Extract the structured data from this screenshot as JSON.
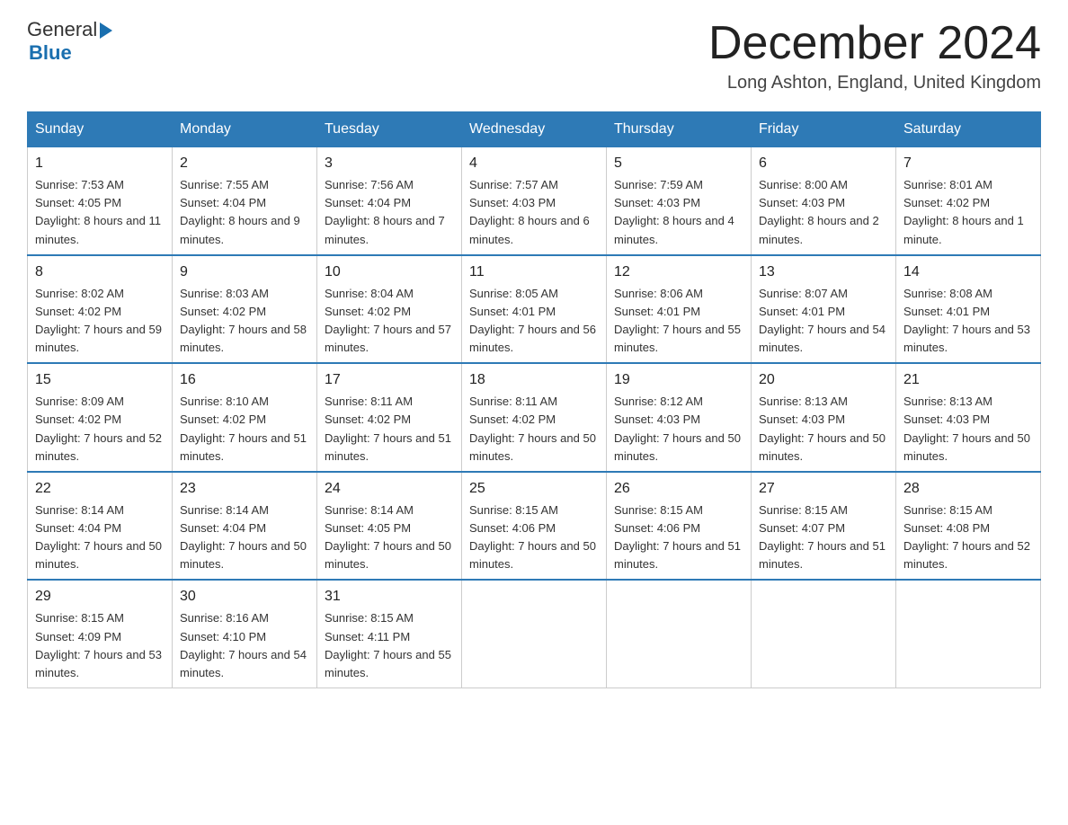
{
  "header": {
    "logo": {
      "general": "General",
      "arrow": "▶",
      "blue": "Blue"
    },
    "title": "December 2024",
    "location": "Long Ashton, England, United Kingdom"
  },
  "weekdays": [
    "Sunday",
    "Monday",
    "Tuesday",
    "Wednesday",
    "Thursday",
    "Friday",
    "Saturday"
  ],
  "weeks": [
    [
      {
        "day": "1",
        "sunrise": "7:53 AM",
        "sunset": "4:05 PM",
        "daylight": "8 hours and 11 minutes."
      },
      {
        "day": "2",
        "sunrise": "7:55 AM",
        "sunset": "4:04 PM",
        "daylight": "8 hours and 9 minutes."
      },
      {
        "day": "3",
        "sunrise": "7:56 AM",
        "sunset": "4:04 PM",
        "daylight": "8 hours and 7 minutes."
      },
      {
        "day": "4",
        "sunrise": "7:57 AM",
        "sunset": "4:03 PM",
        "daylight": "8 hours and 6 minutes."
      },
      {
        "day": "5",
        "sunrise": "7:59 AM",
        "sunset": "4:03 PM",
        "daylight": "8 hours and 4 minutes."
      },
      {
        "day": "6",
        "sunrise": "8:00 AM",
        "sunset": "4:03 PM",
        "daylight": "8 hours and 2 minutes."
      },
      {
        "day": "7",
        "sunrise": "8:01 AM",
        "sunset": "4:02 PM",
        "daylight": "8 hours and 1 minute."
      }
    ],
    [
      {
        "day": "8",
        "sunrise": "8:02 AM",
        "sunset": "4:02 PM",
        "daylight": "7 hours and 59 minutes."
      },
      {
        "day": "9",
        "sunrise": "8:03 AM",
        "sunset": "4:02 PM",
        "daylight": "7 hours and 58 minutes."
      },
      {
        "day": "10",
        "sunrise": "8:04 AM",
        "sunset": "4:02 PM",
        "daylight": "7 hours and 57 minutes."
      },
      {
        "day": "11",
        "sunrise": "8:05 AM",
        "sunset": "4:01 PM",
        "daylight": "7 hours and 56 minutes."
      },
      {
        "day": "12",
        "sunrise": "8:06 AM",
        "sunset": "4:01 PM",
        "daylight": "7 hours and 55 minutes."
      },
      {
        "day": "13",
        "sunrise": "8:07 AM",
        "sunset": "4:01 PM",
        "daylight": "7 hours and 54 minutes."
      },
      {
        "day": "14",
        "sunrise": "8:08 AM",
        "sunset": "4:01 PM",
        "daylight": "7 hours and 53 minutes."
      }
    ],
    [
      {
        "day": "15",
        "sunrise": "8:09 AM",
        "sunset": "4:02 PM",
        "daylight": "7 hours and 52 minutes."
      },
      {
        "day": "16",
        "sunrise": "8:10 AM",
        "sunset": "4:02 PM",
        "daylight": "7 hours and 51 minutes."
      },
      {
        "day": "17",
        "sunrise": "8:11 AM",
        "sunset": "4:02 PM",
        "daylight": "7 hours and 51 minutes."
      },
      {
        "day": "18",
        "sunrise": "8:11 AM",
        "sunset": "4:02 PM",
        "daylight": "7 hours and 50 minutes."
      },
      {
        "day": "19",
        "sunrise": "8:12 AM",
        "sunset": "4:03 PM",
        "daylight": "7 hours and 50 minutes."
      },
      {
        "day": "20",
        "sunrise": "8:13 AM",
        "sunset": "4:03 PM",
        "daylight": "7 hours and 50 minutes."
      },
      {
        "day": "21",
        "sunrise": "8:13 AM",
        "sunset": "4:03 PM",
        "daylight": "7 hours and 50 minutes."
      }
    ],
    [
      {
        "day": "22",
        "sunrise": "8:14 AM",
        "sunset": "4:04 PM",
        "daylight": "7 hours and 50 minutes."
      },
      {
        "day": "23",
        "sunrise": "8:14 AM",
        "sunset": "4:04 PM",
        "daylight": "7 hours and 50 minutes."
      },
      {
        "day": "24",
        "sunrise": "8:14 AM",
        "sunset": "4:05 PM",
        "daylight": "7 hours and 50 minutes."
      },
      {
        "day": "25",
        "sunrise": "8:15 AM",
        "sunset": "4:06 PM",
        "daylight": "7 hours and 50 minutes."
      },
      {
        "day": "26",
        "sunrise": "8:15 AM",
        "sunset": "4:06 PM",
        "daylight": "7 hours and 51 minutes."
      },
      {
        "day": "27",
        "sunrise": "8:15 AM",
        "sunset": "4:07 PM",
        "daylight": "7 hours and 51 minutes."
      },
      {
        "day": "28",
        "sunrise": "8:15 AM",
        "sunset": "4:08 PM",
        "daylight": "7 hours and 52 minutes."
      }
    ],
    [
      {
        "day": "29",
        "sunrise": "8:15 AM",
        "sunset": "4:09 PM",
        "daylight": "7 hours and 53 minutes."
      },
      {
        "day": "30",
        "sunrise": "8:16 AM",
        "sunset": "4:10 PM",
        "daylight": "7 hours and 54 minutes."
      },
      {
        "day": "31",
        "sunrise": "8:15 AM",
        "sunset": "4:11 PM",
        "daylight": "7 hours and 55 minutes."
      },
      null,
      null,
      null,
      null
    ]
  ]
}
